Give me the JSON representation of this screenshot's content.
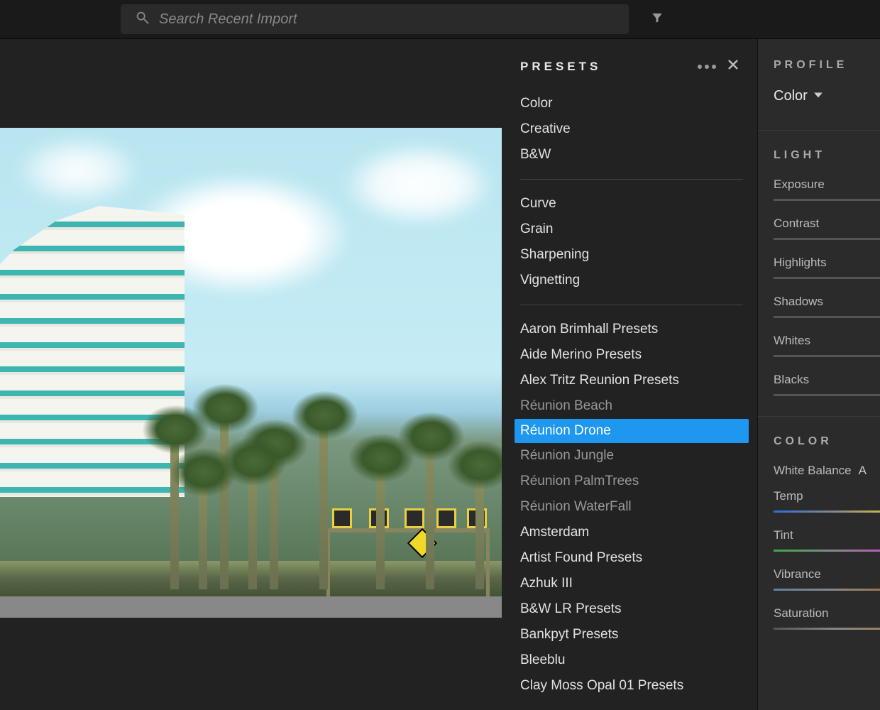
{
  "search": {
    "placeholder": "Search Recent Import"
  },
  "presets": {
    "title": "PRESETS",
    "groups": {
      "g1": [
        "Color",
        "Creative",
        "B&W"
      ],
      "g2": [
        "Curve",
        "Grain",
        "Sharpening",
        "Vignetting"
      ],
      "g3": [
        {
          "label": "Aaron Brimhall Presets",
          "child": false
        },
        {
          "label": "Aide Merino Presets",
          "child": false
        },
        {
          "label": "Alex Tritz Reunion Presets",
          "child": false
        },
        {
          "label": "Réunion Beach",
          "child": true
        },
        {
          "label": "Réunion Drone",
          "child": true,
          "selected": true
        },
        {
          "label": "Réunion Jungle",
          "child": true
        },
        {
          "label": "Réunion PalmTrees",
          "child": true
        },
        {
          "label": "Réunion WaterFall",
          "child": true
        },
        {
          "label": "Amsterdam",
          "child": false
        },
        {
          "label": "Artist Found Presets",
          "child": false
        },
        {
          "label": "Azhuk III",
          "child": false
        },
        {
          "label": "B&W LR Presets",
          "child": false
        },
        {
          "label": "Bankpyt Presets",
          "child": false
        },
        {
          "label": "Bleeblu",
          "child": false
        },
        {
          "label": "Clay Moss Opal 01 Presets",
          "child": false
        }
      ]
    }
  },
  "profile": {
    "title": "PROFILE",
    "value": "Color"
  },
  "light": {
    "title": "LIGHT",
    "sliders": {
      "exposure": "Exposure",
      "contrast": "Contrast",
      "highlights": "Highlights",
      "shadows": "Shadows",
      "whites": "Whites",
      "blacks": "Blacks"
    }
  },
  "color": {
    "title": "COLOR",
    "wb_label": "White Balance",
    "wb_value": "A",
    "temp": "Temp",
    "tint": "Tint",
    "vibrance": "Vibrance",
    "saturation": "Saturation"
  }
}
